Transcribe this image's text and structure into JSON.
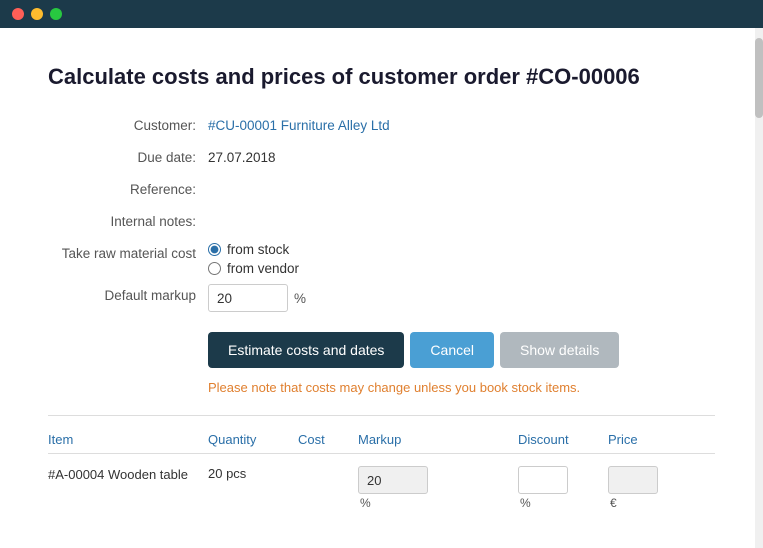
{
  "titlebar": {
    "btn_close_label": "close",
    "btn_min_label": "minimize",
    "btn_max_label": "maximize"
  },
  "page": {
    "title": "Calculate costs and prices of customer order #CO-00006"
  },
  "form": {
    "customer_label": "Customer:",
    "customer_value": "#CU-00001 Furniture Alley Ltd",
    "due_date_label": "Due date:",
    "due_date_value": "27.07.2018",
    "reference_label": "Reference:",
    "reference_value": "",
    "internal_notes_label": "Internal notes:",
    "internal_notes_value": "",
    "raw_material_label": "Take raw material cost",
    "from_stock_label": "from stock",
    "from_vendor_label": "from vendor",
    "default_markup_label": "Default markup",
    "default_markup_value": "20",
    "markup_unit": "%",
    "estimate_btn": "Estimate costs and dates",
    "cancel_btn": "Cancel",
    "show_details_btn": "Show details",
    "notice": "Please note that costs may change unless you book stock items."
  },
  "table": {
    "col_item": "Item",
    "col_quantity": "Quantity",
    "col_cost": "Cost",
    "col_markup": "Markup",
    "col_discount": "Discount",
    "col_price": "Price",
    "rows": [
      {
        "item": "#A-00004 Wooden table",
        "quantity": "20 pcs",
        "cost": "",
        "markup_value": "20",
        "markup_unit": "%",
        "discount_value": "",
        "discount_unit": "%",
        "price_value": "",
        "price_unit": "€"
      }
    ]
  }
}
